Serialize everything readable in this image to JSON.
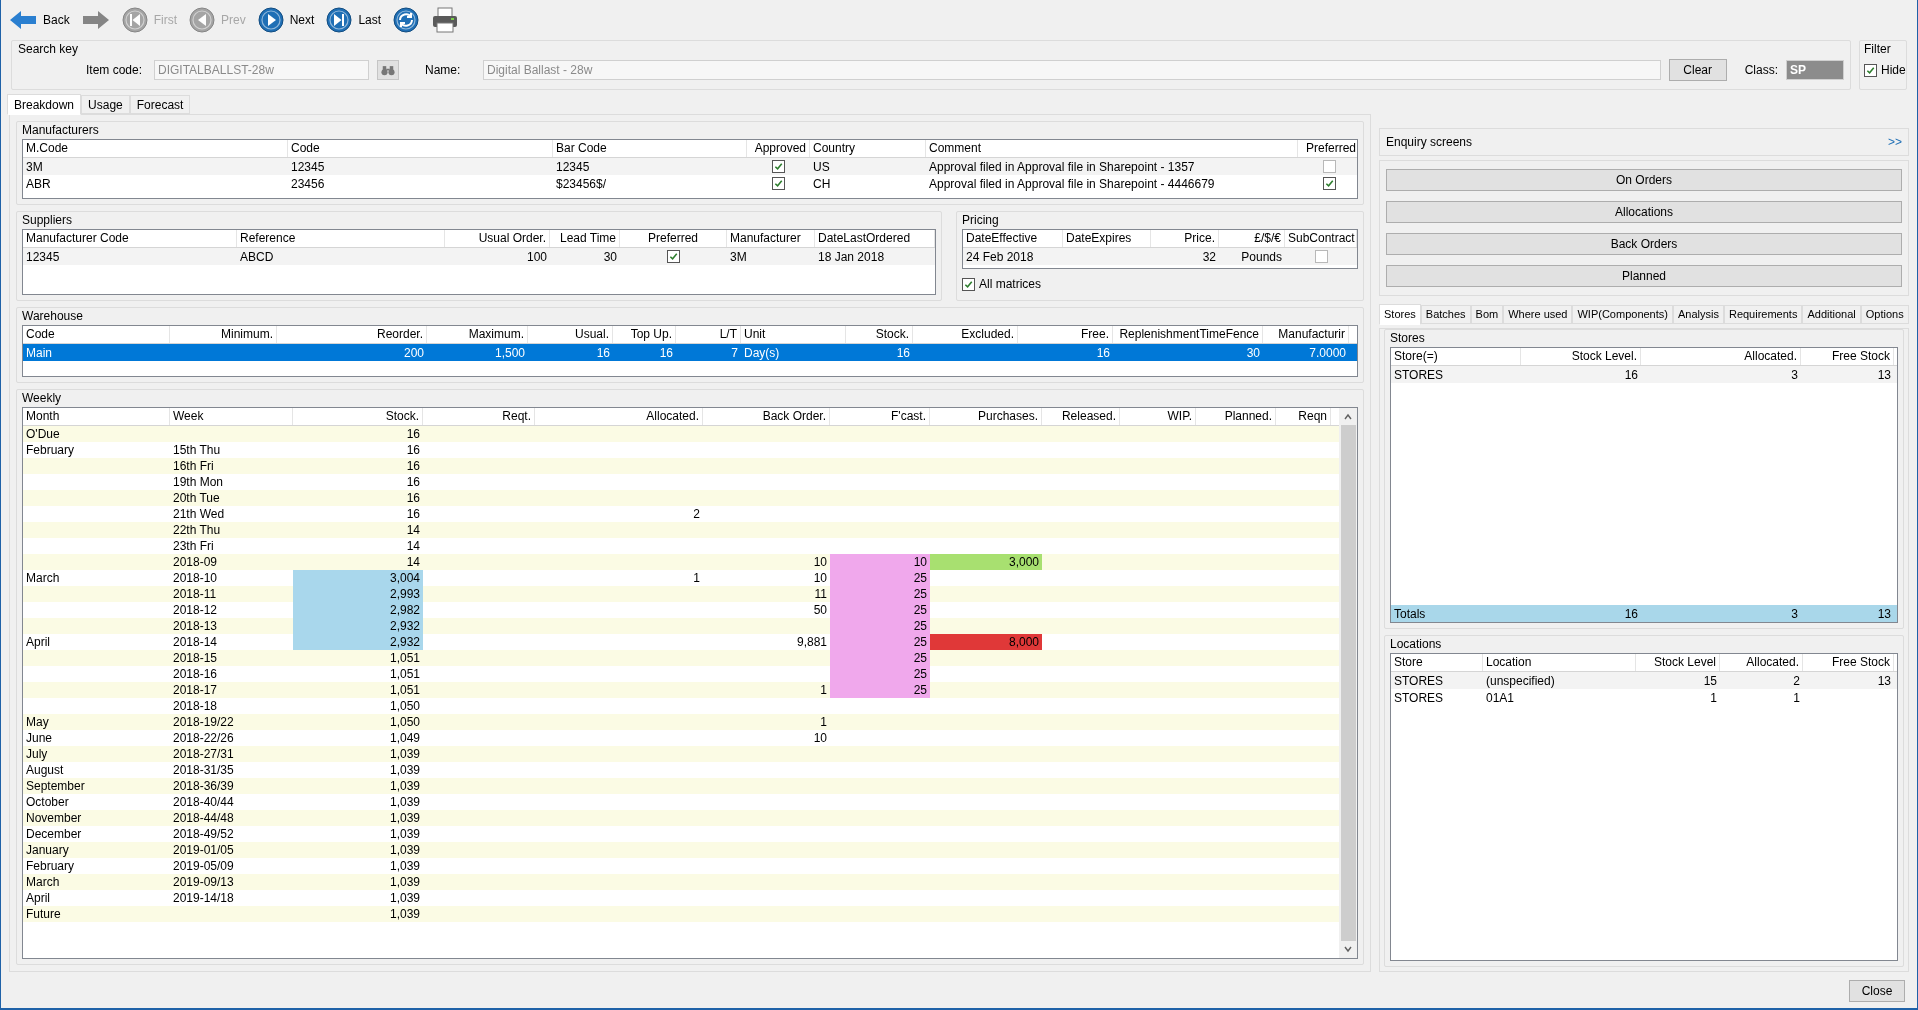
{
  "toolbar": [
    {
      "kind": "back",
      "label": "Back",
      "disabled": false
    },
    {
      "kind": "forward",
      "disabled": true
    },
    {
      "kind": "first",
      "label": "First",
      "disabled": true
    },
    {
      "kind": "prev",
      "label": "Prev",
      "disabled": true
    },
    {
      "kind": "next",
      "label": "Next",
      "disabled": false
    },
    {
      "kind": "last",
      "label": "Last",
      "disabled": false
    },
    {
      "kind": "refresh",
      "disabled": false
    },
    {
      "kind": "print"
    }
  ],
  "search_key": {
    "title": "Search key",
    "item_code_label": "Item code:",
    "item_code": "DIGITALBALLST-28w",
    "name_label": "Name:",
    "name": "Digital Ballast - 28w",
    "clear_button": "Clear",
    "class_label": "Class:",
    "class_value": "SP"
  },
  "filter": {
    "title": "Filter",
    "hide_label": "Hide",
    "hide_checked": true
  },
  "tabs": [
    {
      "label": "Breakdown",
      "selected": true
    },
    {
      "label": "Usage",
      "selected": false
    },
    {
      "label": "Forecast",
      "selected": false
    }
  ],
  "manufacturers": {
    "title": "Manufacturers",
    "columns": [
      "M.Code",
      "Code",
      "Bar Code",
      "Approved",
      "Country",
      "Comment",
      "Preferred"
    ],
    "rows": [
      {
        "m_code": "3M",
        "code": "12345",
        "bar_code": "12345",
        "approved": true,
        "country": "US",
        "comment": "Approval filed in Approval file in Sharepoint - 1357",
        "preferred": false
      },
      {
        "m_code": "ABR",
        "code": "23456",
        "bar_code": "$23456$/",
        "approved": true,
        "country": "CH",
        "comment": "Approval filed in Approval file in Sharepoint - 4446679",
        "preferred": true
      }
    ]
  },
  "suppliers": {
    "title": "Suppliers",
    "columns": [
      "Manufacturer Code",
      "Reference",
      "Usual Order.",
      "Lead Time",
      "Preferred",
      "Manufacturer",
      "DateLastOrdered"
    ],
    "rows": [
      {
        "manufacturer_code": "12345",
        "reference": "ABCD",
        "usual_order": "100",
        "lead_time": "30",
        "preferred": true,
        "manufacturer": "3M",
        "date_last_ordered": "18 Jan 2018"
      }
    ]
  },
  "pricing": {
    "title": "Pricing",
    "columns": [
      "DateEffective",
      "DateExpires",
      "Price.",
      "£/$/€",
      "SubContract"
    ],
    "rows": [
      {
        "date_effective": "24 Feb 2018",
        "price": "32",
        "currency": "Pounds",
        "subcontract": false
      }
    ],
    "all_matrices_label": "All matrices",
    "all_matrices_checked": true
  },
  "warehouse": {
    "title": "Warehouse",
    "columns": [
      "Code",
      "Minimum.",
      "Reorder.",
      "Maximum.",
      "Usual.",
      "Top Up.",
      "L/T",
      "Unit",
      "Stock.",
      "Excluded.",
      "Free.",
      "ReplenishmentTimeFence",
      "Manufacturir"
    ],
    "rows": [
      {
        "code": "Main",
        "reorder": "200",
        "maximum": "1,500",
        "usual": "16",
        "top_up": "16",
        "lt": "7",
        "unit": "Day(s)",
        "stock": "16",
        "free": "16",
        "fence": "30",
        "manufacturing": "7.0000",
        "selected": true
      }
    ]
  },
  "weekly": {
    "title": "Weekly",
    "columns": [
      "Month",
      "Week",
      "Stock.",
      "Reqt.",
      "Allocated.",
      "Back Order.",
      "F'cast.",
      "Purchases.",
      "Released.",
      "WIP.",
      "Planned.",
      "Reqn"
    ],
    "rows": [
      {
        "month": "O'Due",
        "stock": "16"
      },
      {
        "month": "February",
        "week": "15th Thu",
        "stock": "16"
      },
      {
        "week": "16th Fri",
        "stock": "16"
      },
      {
        "week": "19th Mon",
        "stock": "16"
      },
      {
        "week": "20th Tue",
        "stock": "16"
      },
      {
        "week": "21th Wed",
        "stock": "16",
        "allocated": "2"
      },
      {
        "week": "22th Thu",
        "stock": "14"
      },
      {
        "week": "23th Fri",
        "stock": "14"
      },
      {
        "week": "2018-09",
        "stock": "14",
        "back_order": "10",
        "fcast": {
          "text": "10",
          "color": "#f0a8ec"
        },
        "purchases": {
          "text": "3,000",
          "color": "#a8e070"
        }
      },
      {
        "month": "March",
        "week": "2018-10",
        "stock": {
          "text": "3,004",
          "color": "#a9d7ec"
        },
        "allocated": "1",
        "back_order": "10",
        "fcast": {
          "text": "25",
          "color": "#f0a8ec"
        }
      },
      {
        "week": "2018-11",
        "stock": {
          "text": "2,993",
          "color": "#a9d7ec"
        },
        "back_order": "11",
        "fcast": {
          "text": "25",
          "color": "#f0a8ec"
        }
      },
      {
        "week": "2018-12",
        "stock": {
          "text": "2,982",
          "color": "#a9d7ec"
        },
        "back_order": "50",
        "fcast": {
          "text": "25",
          "color": "#f0a8ec"
        }
      },
      {
        "week": "2018-13",
        "stock": {
          "text": "2,932",
          "color": "#a9d7ec"
        },
        "fcast": {
          "text": "25",
          "color": "#f0a8ec"
        }
      },
      {
        "month": "April",
        "week": "2018-14",
        "stock": {
          "text": "2,932",
          "color": "#a9d7ec"
        },
        "back_order": "9,881",
        "fcast": {
          "text": "25",
          "color": "#f0a8ec"
        },
        "purchases": {
          "text": "8,000",
          "color": "#e03838"
        }
      },
      {
        "week": "2018-15",
        "stock": "1,051",
        "fcast": {
          "text": "25",
          "color": "#f0a8ec"
        }
      },
      {
        "week": "2018-16",
        "stock": "1,051",
        "fcast": {
          "text": "25",
          "color": "#f0a8ec"
        }
      },
      {
        "week": "2018-17",
        "stock": "1,051",
        "back_order": "1",
        "fcast": {
          "text": "25",
          "color": "#f0a8ec"
        }
      },
      {
        "week": "2018-18",
        "stock": "1,050"
      },
      {
        "month": "May",
        "week": "2018-19/22",
        "stock": "1,050",
        "back_order": "1"
      },
      {
        "month": "June",
        "week": "2018-22/26",
        "stock": "1,049",
        "back_order": "10"
      },
      {
        "month": "July",
        "week": "2018-27/31",
        "stock": "1,039"
      },
      {
        "month": "August",
        "week": "2018-31/35",
        "stock": "1,039"
      },
      {
        "month": "September",
        "week": "2018-36/39",
        "stock": "1,039"
      },
      {
        "month": "October",
        "week": "2018-40/44",
        "stock": "1,039"
      },
      {
        "month": "November",
        "week": "2018-44/48",
        "stock": "1,039"
      },
      {
        "month": "December",
        "week": "2018-49/52",
        "stock": "1,039"
      },
      {
        "month": "January",
        "week": "2019-01/05",
        "stock": "1,039"
      },
      {
        "month": "February",
        "week": "2019-05/09",
        "stock": "1,039"
      },
      {
        "month": "March",
        "week": "2019-09/13",
        "stock": "1,039"
      },
      {
        "month": "April",
        "week": "2019-14/18",
        "stock": "1,039"
      },
      {
        "month": "Future",
        "stock": "1,039"
      }
    ]
  },
  "enquiry": {
    "title": "Enquiry screens",
    "expand": ">>",
    "buttons": [
      "On Orders",
      "Allocations",
      "Back Orders",
      "Planned"
    ]
  },
  "side_tabs": [
    {
      "label": "Stores",
      "selected": true
    },
    {
      "label": "Batches",
      "selected": false
    },
    {
      "label": "Bom",
      "selected": false
    },
    {
      "label": "Where used",
      "selected": false
    },
    {
      "label": "WIP(Components)",
      "selected": false
    },
    {
      "label": "Analysis",
      "selected": false
    },
    {
      "label": "Requirements",
      "selected": false
    },
    {
      "label": "Additional",
      "selected": false
    },
    {
      "label": "Options",
      "selected": false
    }
  ],
  "stores": {
    "title": "Stores",
    "columns": [
      "Store(=)",
      "Stock Level.",
      "Allocated.",
      "Free Stock"
    ],
    "rows": [
      {
        "store": "STORES",
        "stock_level": "16",
        "allocated": "3",
        "free_stock": "13"
      }
    ],
    "totals": {
      "store": "Totals",
      "stock_level": "16",
      "allocated": "3",
      "free_stock": "13"
    }
  },
  "locations": {
    "title": "Locations",
    "columns": [
      "Store",
      "Location",
      "Stock Level",
      "Allocated.",
      "Free Stock"
    ],
    "rows": [
      {
        "store": "STORES",
        "location": "(unspecified)",
        "stock_level": "15",
        "allocated": "2",
        "free_stock": "13"
      },
      {
        "store": "STORES",
        "location": "01A1",
        "stock_level": "1",
        "allocated": "1"
      }
    ]
  },
  "close_button": "Close"
}
